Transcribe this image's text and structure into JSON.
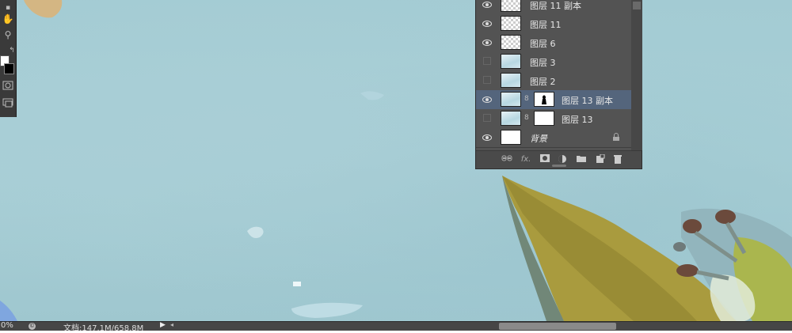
{
  "toolbar": {
    "tools": [
      {
        "name": "hand-tool-icon",
        "glyph": "✋"
      },
      {
        "name": "zoom-tool-icon",
        "glyph": "⚲"
      },
      {
        "name": "swap-colors-icon",
        "glyph": "↰"
      },
      {
        "name": "quick-mask-icon",
        "glyph": "◙"
      },
      {
        "name": "screen-mode-icon",
        "glyph": "▭"
      }
    ],
    "foreground_color": "#ffffff",
    "background_color": "#000000"
  },
  "layers": [
    {
      "name": "图层 11 副本",
      "visible": true,
      "thumb": "checker",
      "mask": false,
      "selected": false
    },
    {
      "name": "图层 11",
      "visible": true,
      "thumb": "checker",
      "mask": false,
      "selected": false
    },
    {
      "name": "图层 6",
      "visible": true,
      "thumb": "checker",
      "mask": false,
      "selected": false
    },
    {
      "name": "图层 3",
      "visible": false,
      "thumb": "blueimg",
      "mask": false,
      "selected": false
    },
    {
      "name": "图层 2",
      "visible": false,
      "thumb": "blueimg",
      "mask": false,
      "selected": false
    },
    {
      "name": "图层 13 副本",
      "visible": true,
      "thumb": "blueimg",
      "mask": true,
      "mask_type": "figure",
      "selected": true
    },
    {
      "name": "图层 13",
      "visible": false,
      "thumb": "blueimg",
      "mask": true,
      "mask_type": "white",
      "selected": false
    },
    {
      "name": "背景",
      "visible": true,
      "thumb": "white",
      "mask": false,
      "selected": false,
      "locked": true
    }
  ],
  "layer_footer": {
    "fx_label": "fx.",
    "buttons": [
      "link-layers-icon",
      "fx-icon",
      "add-mask-icon",
      "adjustment-layer-icon",
      "new-group-icon",
      "new-layer-icon",
      "delete-layer-icon"
    ]
  },
  "status_bar": {
    "zoom": "0%",
    "doc_info": "文档:147.1M/658.8M"
  },
  "colors": {
    "panel_bg": "#535353",
    "selected_row": "#54657c",
    "canvas_blue": "#a6cdd4"
  }
}
